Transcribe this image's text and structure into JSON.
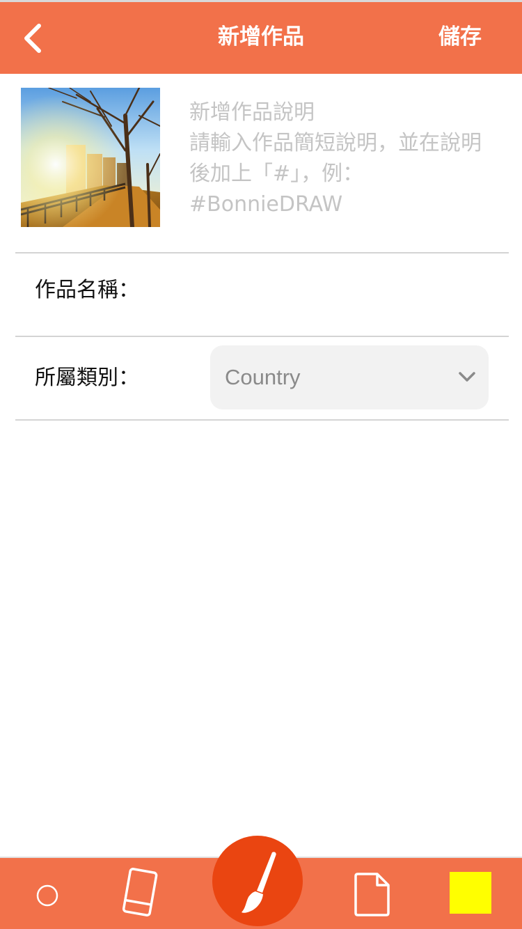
{
  "header": {
    "title": "新增作品",
    "save_label": "儲存",
    "back_icon": "chevron-left-icon"
  },
  "artwork": {
    "description_placeholder": "新增作品說明\n請輸入作品簡短說明，並在說明後加上「#」，例：\n#BonnieDRAW"
  },
  "form": {
    "name_label": "作品名稱：",
    "name_value": "",
    "category_label": "所屬類別：",
    "category_value": "Country",
    "category_icon": "chevron-down-icon"
  },
  "toolbar": {
    "items": [
      {
        "icon": "circle-brush-size-icon"
      },
      {
        "icon": "eraser-icon"
      },
      {
        "icon": "paintbrush-icon"
      },
      {
        "icon": "new-page-icon"
      },
      {
        "icon": "color-swatch"
      }
    ],
    "current_color": "#ffff00"
  },
  "colors": {
    "accent": "#f2714a",
    "brush_button": "#ea4511"
  }
}
